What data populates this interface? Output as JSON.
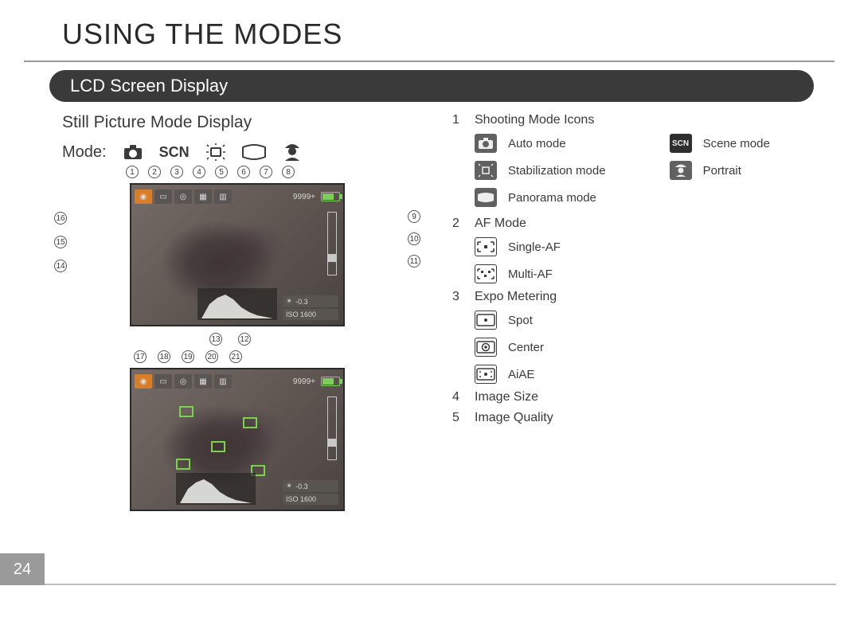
{
  "page": {
    "chapter_title": "USING THE MODES",
    "section_title": "LCD Screen Display",
    "subheading": "Still Picture Mode Display",
    "mode_label": "Mode:",
    "mode_codes": {
      "scn": "SCN"
    },
    "page_number": "24"
  },
  "lcd": {
    "shots_remaining": "9999+",
    "exposure_value": "-0.3",
    "iso_value": "ISO 1600"
  },
  "callouts": {
    "top1": [
      "1",
      "2",
      "3",
      "4",
      "5",
      "6",
      "7",
      "8"
    ],
    "right1": [
      "9",
      "10",
      "11"
    ],
    "left1": [
      "16",
      "15",
      "14"
    ],
    "bottom1": [
      "13",
      "12"
    ],
    "top2": [
      "17",
      "18",
      "19",
      "20",
      "21"
    ]
  },
  "legend": {
    "one": {
      "num": "1",
      "title": "Shooting Mode Icons",
      "left": [
        {
          "label": "Auto mode"
        },
        {
          "label": "Stabilization mode"
        },
        {
          "label": "Panorama mode"
        }
      ],
      "right": [
        {
          "code": "SCN",
          "label": "Scene mode"
        },
        {
          "label": "Portrait"
        }
      ]
    },
    "two": {
      "num": "2",
      "title": "AF Mode",
      "items": [
        {
          "label": "Single-AF"
        },
        {
          "label": "Multi-AF"
        }
      ]
    },
    "three": {
      "num": "3",
      "title": "Expo Metering",
      "items": [
        {
          "label": "Spot"
        },
        {
          "label": "Center"
        },
        {
          "label": "AiAE"
        }
      ]
    },
    "four": {
      "num": "4",
      "title": "Image Size"
    },
    "five": {
      "num": "5",
      "title": "Image Quality"
    }
  }
}
